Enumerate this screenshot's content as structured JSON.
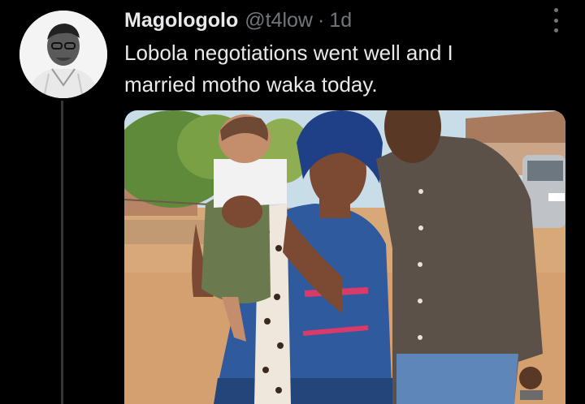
{
  "tweet": {
    "display_name": "Magologolo",
    "handle": "@t4low",
    "separator": "·",
    "time": "1d",
    "text_line1": "Lobola negotiations went well and I",
    "text_line2": "married motho waka today."
  },
  "icons": {
    "more": "more-vertical-icon",
    "avatar": "profile-photo"
  },
  "colors": {
    "background": "#000000",
    "primary_text": "#e7e9ea",
    "secondary_text": "#71767b",
    "thread_line": "#333639"
  }
}
